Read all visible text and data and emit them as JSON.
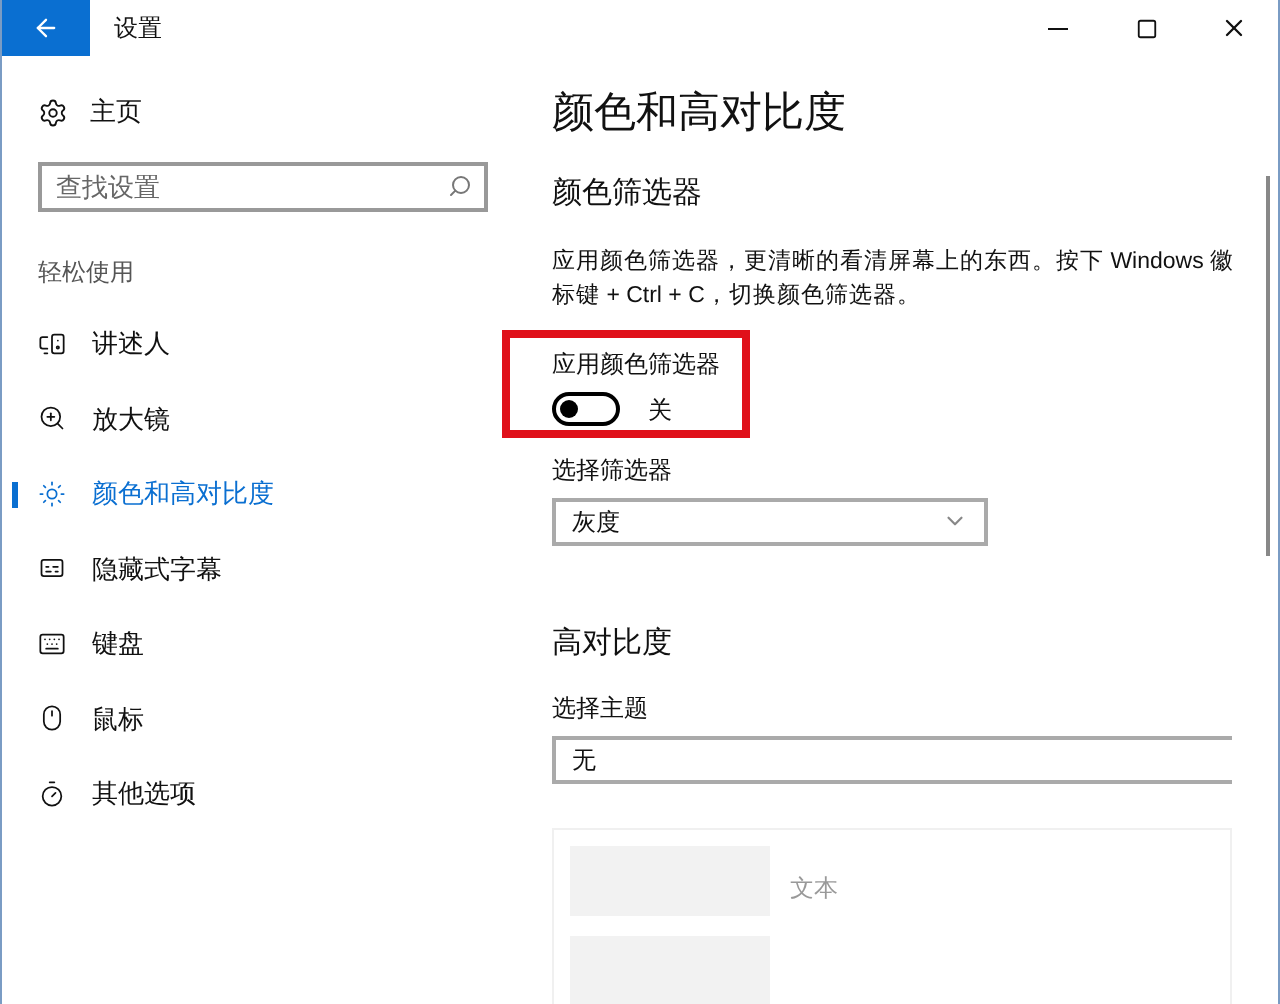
{
  "window": {
    "title": "设置"
  },
  "sidebar": {
    "home": "主页",
    "search": {
      "placeholder": "查找设置"
    },
    "section": "轻松使用",
    "items": [
      {
        "label": "讲述人",
        "selected": false
      },
      {
        "label": "放大镜",
        "selected": false
      },
      {
        "label": "颜色和高对比度",
        "selected": true
      },
      {
        "label": "隐藏式字幕",
        "selected": false
      },
      {
        "label": "键盘",
        "selected": false
      },
      {
        "label": "鼠标",
        "selected": false
      },
      {
        "label": "其他选项",
        "selected": false
      }
    ]
  },
  "content": {
    "title": "颜色和高对比度",
    "filter_heading": "颜色筛选器",
    "description": "应用颜色筛选器，更清晰的看清屏幕上的东西。按下 Windows 徽标键 + Ctrl + C，切换颜色筛选器。",
    "toggle": {
      "label": "应用颜色筛选器",
      "on": false,
      "state_text": "关"
    },
    "filter_select": {
      "label": "选择筛选器",
      "value": "灰度"
    },
    "contrast_heading": "高对比度",
    "theme_select": {
      "label": "选择主题",
      "value": "无"
    },
    "preview": {
      "text_label": "文本"
    }
  }
}
